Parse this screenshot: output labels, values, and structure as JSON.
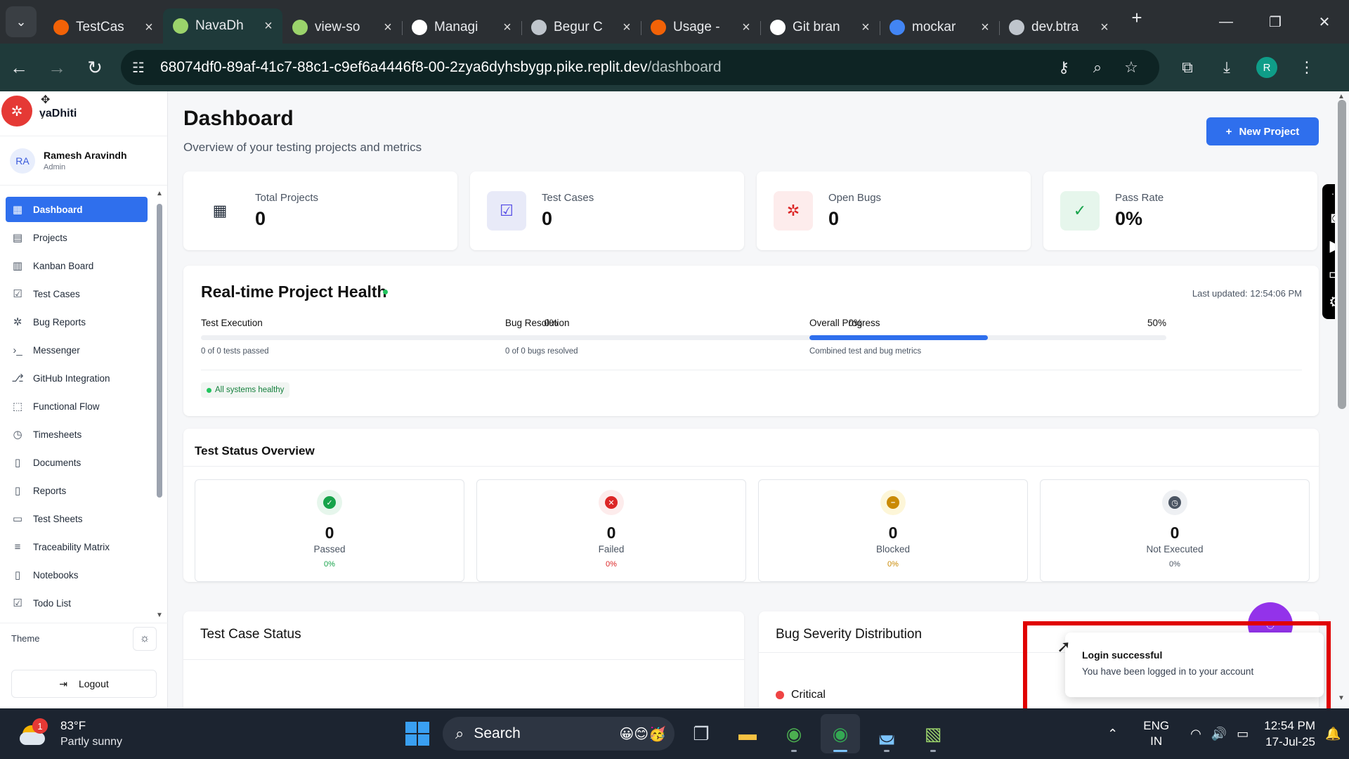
{
  "browser": {
    "tabs": [
      {
        "title": "TestCas",
        "favicon_color": "#f26207",
        "active": false
      },
      {
        "title": "NavaDh",
        "favicon_color": "#9bd36b",
        "active": true
      },
      {
        "title": "view-so",
        "favicon_color": "#9bd36b",
        "active": false
      },
      {
        "title": "Managi",
        "favicon_color": "#ffffff",
        "active": false
      },
      {
        "title": "Begur C",
        "favicon_color": "#bfc5cc",
        "active": false
      },
      {
        "title": "Usage -",
        "favicon_color": "#f26207",
        "active": false
      },
      {
        "title": "Git bran",
        "favicon_color": "#ffffff",
        "active": false
      },
      {
        "title": "mockar",
        "favicon_color": "#4285f4",
        "active": false
      },
      {
        "title": "dev.btra",
        "favicon_color": "#bfc5cc",
        "active": false
      }
    ],
    "url_host": "68074df0-89af-41c7-88c1-c9ef6a4446f8-00-2zya6dyhsbygp.pike.replit.dev",
    "url_path": "/dashboard",
    "profile_initial": "R"
  },
  "sidebar": {
    "brand": "vaDhiti",
    "user": {
      "initials": "RA",
      "name": "Ramesh Aravindh",
      "role": "Admin"
    },
    "items": [
      {
        "label": "Dashboard",
        "icon": "grid-icon",
        "glyph": "▦",
        "active": true
      },
      {
        "label": "Projects",
        "icon": "projects-icon",
        "glyph": "▤",
        "active": false
      },
      {
        "label": "Kanban Board",
        "icon": "kanban-icon",
        "glyph": "▥",
        "active": false
      },
      {
        "label": "Test Cases",
        "icon": "checkbox-icon",
        "glyph": "☑",
        "active": false
      },
      {
        "label": "Bug Reports",
        "icon": "bug-icon",
        "glyph": "✲",
        "active": false
      },
      {
        "label": "Messenger",
        "icon": "terminal-icon",
        "glyph": "›_",
        "active": false
      },
      {
        "label": "GitHub Integration",
        "icon": "github-icon",
        "glyph": "⎇",
        "active": false
      },
      {
        "label": "Functional Flow",
        "icon": "flow-icon",
        "glyph": "⬚",
        "active": false
      },
      {
        "label": "Timesheets",
        "icon": "clock-icon",
        "glyph": "◷",
        "active": false
      },
      {
        "label": "Documents",
        "icon": "document-icon",
        "glyph": "▯",
        "active": false
      },
      {
        "label": "Reports",
        "icon": "report-icon",
        "glyph": "▯",
        "active": false
      },
      {
        "label": "Test Sheets",
        "icon": "sheet-icon",
        "glyph": "▭",
        "active": false
      },
      {
        "label": "Traceability Matrix",
        "icon": "filter-icon",
        "glyph": "≡",
        "active": false
      },
      {
        "label": "Notebooks",
        "icon": "notebook-icon",
        "glyph": "▯",
        "active": false
      },
      {
        "label": "Todo List",
        "icon": "todo-icon",
        "glyph": "☑",
        "active": false
      }
    ],
    "theme_label": "Theme",
    "logout_label": "Logout"
  },
  "header": {
    "title": "Dashboard",
    "subtitle": "Overview of your testing projects and metrics",
    "new_project": "New Project"
  },
  "stats": [
    {
      "label": "Total Projects",
      "value": "0",
      "icon": "projects-chart-icon",
      "color": "#1f2937",
      "bg": "#ffffff"
    },
    {
      "label": "Test Cases",
      "value": "0",
      "icon": "checkbox-icon",
      "color": "#4f46e5",
      "bg": "#e8eaf8"
    },
    {
      "label": "Open Bugs",
      "value": "0",
      "icon": "bug-icon",
      "color": "#dc2626",
      "bg": "#fdecec"
    },
    {
      "label": "Pass Rate",
      "value": "0%",
      "icon": "check-circle-icon",
      "color": "#16a34a",
      "bg": "#e6f6ec"
    }
  ],
  "health": {
    "title": "Real-time Project Health",
    "last_updated": "Last updated: 12:54:06 PM",
    "metrics": [
      {
        "label": "Test Execution",
        "percent_label": "0%",
        "progress": 0,
        "caption": "0 of 0 tests passed"
      },
      {
        "label": "Bug Resolution",
        "percent_label": "0%",
        "progress": 0,
        "caption": "0 of 0 bugs resolved"
      },
      {
        "label": "Overall Progress",
        "percent_label": "50%",
        "progress": 0.5,
        "caption": "Combined test and bug metrics"
      }
    ],
    "status": "All systems healthy"
  },
  "test_status": {
    "title": "Test Status Overview",
    "tiles": [
      {
        "value": "0",
        "label": "Passed",
        "percent": "0%",
        "color": "#16a34a",
        "bg": "#e6f6ec",
        "glyph": "✓",
        "icon": "check-circle-icon"
      },
      {
        "value": "0",
        "label": "Failed",
        "percent": "0%",
        "color": "#dc2626",
        "bg": "#fdecec",
        "glyph": "✕",
        "icon": "x-circle-icon"
      },
      {
        "value": "0",
        "label": "Blocked",
        "percent": "0%",
        "color": "#ca8a04",
        "bg": "#fdf6d8",
        "glyph": "–",
        "icon": "blocked-circle-icon"
      },
      {
        "value": "0",
        "label": "Not Executed",
        "percent": "0%",
        "color": "#4b5563",
        "bg": "#eef0f3",
        "glyph": "◷",
        "icon": "clock-icon"
      }
    ]
  },
  "panels": {
    "test_case_status": "Test Case Status",
    "bug_severity": "Bug Severity Distribution",
    "critical_label": "Critical"
  },
  "toast": {
    "title": "Login successful",
    "message": "You have been logged in to your account"
  },
  "taskbar": {
    "temp": "83°F",
    "weather": "Partly sunny",
    "weather_badge": "1",
    "search": "Search",
    "lang1": "ENG",
    "lang2": "IN",
    "time": "12:54 PM",
    "date": "17-Jul-25"
  }
}
